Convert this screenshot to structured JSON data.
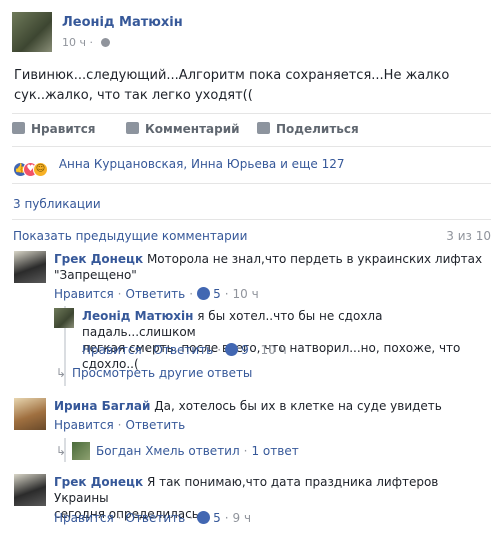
{
  "post": {
    "author": "Леонід Матюхін",
    "time": "10 ч",
    "text_line1": "Гивинюк...следующий...Алгоритм пока сохраняется...Не жалко",
    "text_line2": "сук..жалко, что так легко уходят(("
  },
  "actions": {
    "like": "Нравится",
    "comment": "Комментарий",
    "share": "Поделиться"
  },
  "reactions": {
    "names": "Анна Курцановская, Инна Юрьева и еще 127"
  },
  "shares": "3 публикации",
  "comments_header": {
    "previous": "Показать предыдущие комментарии",
    "count": "3 из 10"
  },
  "comments": [
    {
      "name": "Грек Донецк",
      "text_line1": "Моторола не знал,что пердеть в украинских лифтах",
      "text_line2": "\"Запрещено\"",
      "like": "Нравится",
      "reply": "Ответить",
      "likes": "5",
      "time": "10 ч"
    },
    {
      "name": "Леонід Матюхін",
      "text_line1": "я бы хотел..что бы не сдохла падаль...слишком",
      "text_line2": "легкая смерть, после всего, что натворил...но, похоже, что сдохло..(",
      "like": "Нравится",
      "reply": "Ответить",
      "likes": "9",
      "time": "10 ч"
    },
    {
      "name": "Ирина Баглай",
      "text_line1": "Да, хотелось бы их в клетке на суде увидеть",
      "like": "Нравится",
      "reply": "Ответить"
    },
    {
      "name": "Грек Донецк",
      "text_line1": "Я так понимаю,что дата праздника лифтеров Украины",
      "text_line2": "сегодня определилась.",
      "like": "Нравится",
      "reply": "Ответить",
      "likes": "5",
      "time": "9 ч"
    }
  ],
  "replies": {
    "see_more": "Просмотреть другие ответы",
    "bogdan": "Богдан Хмель ответил",
    "bogdan_count": "1 ответ"
  },
  "colors": {
    "link": "#365899",
    "like_blue": "#4267b2",
    "love_red": "#f25268",
    "haha_yellow": "#f7b125"
  }
}
